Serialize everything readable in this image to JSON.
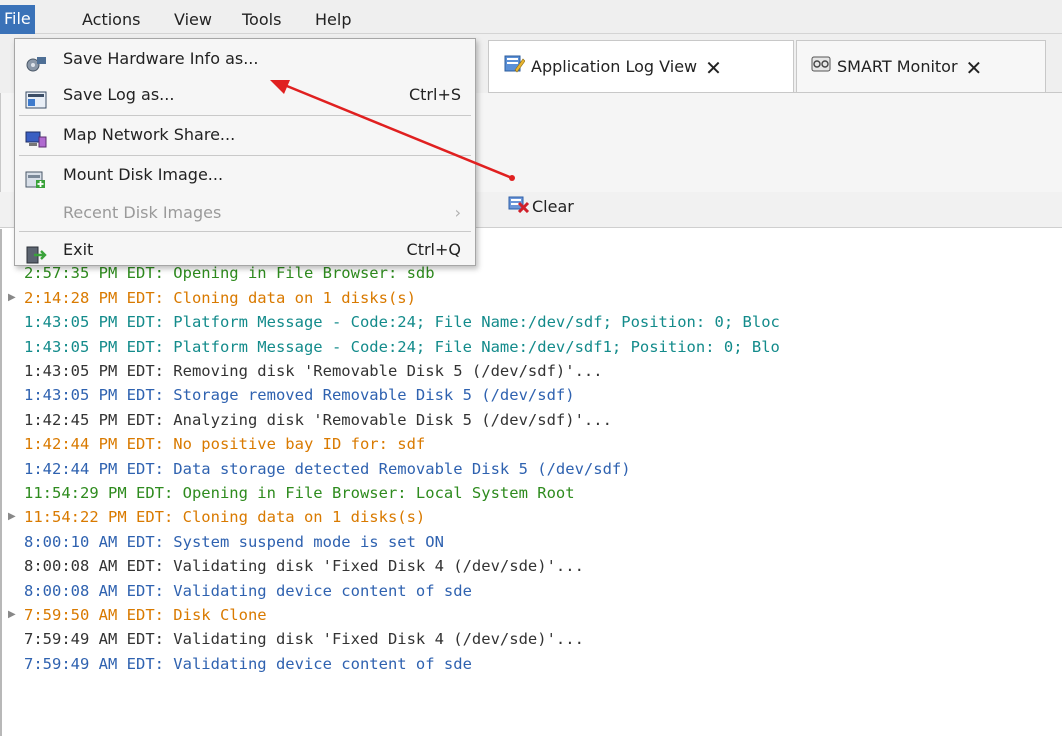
{
  "menubar": {
    "items": [
      {
        "label": "File"
      },
      {
        "label": "Actions"
      },
      {
        "label": "View"
      },
      {
        "label": "Tools"
      },
      {
        "label": "Help"
      }
    ]
  },
  "tabs": [
    {
      "label": "Application Log View",
      "close": "✕"
    },
    {
      "label": "SMART Monitor",
      "close": "✕"
    }
  ],
  "toolbar": {
    "clear_label": "Clear"
  },
  "file_menu": {
    "items": [
      {
        "label": "Save Hardware Info as...",
        "shortcut": ""
      },
      {
        "label": "Save Log as...",
        "shortcut": "Ctrl+S"
      },
      {
        "label": "Map Network Share...",
        "shortcut": ""
      },
      {
        "label": "Mount Disk Image...",
        "shortcut": ""
      },
      {
        "label": "Recent Disk Images",
        "shortcut": "›"
      },
      {
        "label": "Exit",
        "shortcut": "Ctrl+Q"
      }
    ]
  },
  "log": {
    "lines": [
      {
        "text": "2:57:35 PM EDT: Opening in File Browser: sdb",
        "color": "#2e8b1e",
        "expander": false
      },
      {
        "text": "2:57:35 PM EDT: Opening in File Browser: sdb",
        "color": "#2e8b1e",
        "expander": false
      },
      {
        "text": "2:14:28 PM EDT: Cloning data on 1 disks(s)",
        "color": "#d97a00",
        "expander": true
      },
      {
        "text": "1:43:05 PM EDT: Platform Message - Code:24; File Name:/dev/sdf; Position: 0; Bloc",
        "color": "#138b8b",
        "expander": false
      },
      {
        "text": "1:43:05 PM EDT: Platform Message - Code:24; File Name:/dev/sdf1; Position: 0; Blo",
        "color": "#138b8b",
        "expander": false
      },
      {
        "text": "1:43:05 PM EDT: Removing disk 'Removable Disk 5 (/dev/sdf)'...",
        "color": "#333333",
        "expander": false
      },
      {
        "text": "1:43:05 PM EDT: Storage removed Removable Disk 5 (/dev/sdf)",
        "color": "#2f62b0",
        "expander": false
      },
      {
        "text": "1:42:45 PM EDT: Analyzing disk 'Removable Disk 5 (/dev/sdf)'...",
        "color": "#333333",
        "expander": false
      },
      {
        "text": "1:42:44 PM EDT: No positive bay ID for: sdf",
        "color": "#d97a00",
        "expander": false
      },
      {
        "text": "1:42:44 PM EDT: Data storage detected Removable Disk 5 (/dev/sdf)",
        "color": "#2f62b0",
        "expander": false
      },
      {
        "text": "11:54:29 PM EDT: Opening in File Browser: Local System Root",
        "color": "#2e8b1e",
        "expander": false
      },
      {
        "text": "11:54:22 PM EDT: Cloning data on 1 disks(s)",
        "color": "#d97a00",
        "expander": true
      },
      {
        "text": "8:00:10 AM EDT: System suspend mode is set ON",
        "color": "#2f62b0",
        "expander": false
      },
      {
        "text": "8:00:08 AM EDT: Validating disk 'Fixed Disk 4 (/dev/sde)'...",
        "color": "#333333",
        "expander": false
      },
      {
        "text": "8:00:08 AM EDT: Validating device content of sde",
        "color": "#2f62b0",
        "expander": false
      },
      {
        "text": "7:59:50 AM EDT: Disk Clone",
        "color": "#d97a00",
        "expander": true
      },
      {
        "text": "7:59:49 AM EDT: Validating disk 'Fixed Disk 4 (/dev/sde)'...",
        "color": "#333333",
        "expander": false
      },
      {
        "text": "7:59:49 AM EDT: Validating device content of sde",
        "color": "#2f62b0",
        "expander": false
      }
    ]
  },
  "annotation": {
    "arrow_color": "#e02020"
  }
}
